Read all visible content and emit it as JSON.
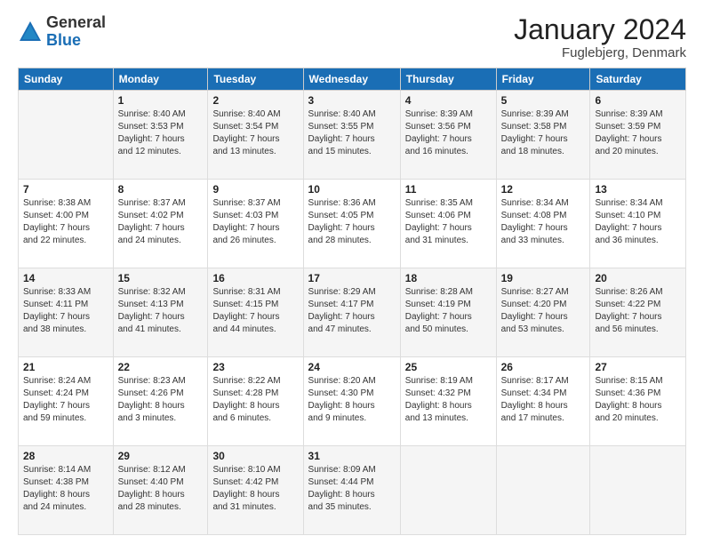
{
  "header": {
    "logo_general": "General",
    "logo_blue": "Blue",
    "month_title": "January 2024",
    "location": "Fuglebjerg, Denmark"
  },
  "days_of_week": [
    "Sunday",
    "Monday",
    "Tuesday",
    "Wednesday",
    "Thursday",
    "Friday",
    "Saturday"
  ],
  "weeks": [
    [
      {
        "day": "",
        "info": ""
      },
      {
        "day": "1",
        "info": "Sunrise: 8:40 AM\nSunset: 3:53 PM\nDaylight: 7 hours\nand 12 minutes."
      },
      {
        "day": "2",
        "info": "Sunrise: 8:40 AM\nSunset: 3:54 PM\nDaylight: 7 hours\nand 13 minutes."
      },
      {
        "day": "3",
        "info": "Sunrise: 8:40 AM\nSunset: 3:55 PM\nDaylight: 7 hours\nand 15 minutes."
      },
      {
        "day": "4",
        "info": "Sunrise: 8:39 AM\nSunset: 3:56 PM\nDaylight: 7 hours\nand 16 minutes."
      },
      {
        "day": "5",
        "info": "Sunrise: 8:39 AM\nSunset: 3:58 PM\nDaylight: 7 hours\nand 18 minutes."
      },
      {
        "day": "6",
        "info": "Sunrise: 8:39 AM\nSunset: 3:59 PM\nDaylight: 7 hours\nand 20 minutes."
      }
    ],
    [
      {
        "day": "7",
        "info": "Sunrise: 8:38 AM\nSunset: 4:00 PM\nDaylight: 7 hours\nand 22 minutes."
      },
      {
        "day": "8",
        "info": "Sunrise: 8:37 AM\nSunset: 4:02 PM\nDaylight: 7 hours\nand 24 minutes."
      },
      {
        "day": "9",
        "info": "Sunrise: 8:37 AM\nSunset: 4:03 PM\nDaylight: 7 hours\nand 26 minutes."
      },
      {
        "day": "10",
        "info": "Sunrise: 8:36 AM\nSunset: 4:05 PM\nDaylight: 7 hours\nand 28 minutes."
      },
      {
        "day": "11",
        "info": "Sunrise: 8:35 AM\nSunset: 4:06 PM\nDaylight: 7 hours\nand 31 minutes."
      },
      {
        "day": "12",
        "info": "Sunrise: 8:34 AM\nSunset: 4:08 PM\nDaylight: 7 hours\nand 33 minutes."
      },
      {
        "day": "13",
        "info": "Sunrise: 8:34 AM\nSunset: 4:10 PM\nDaylight: 7 hours\nand 36 minutes."
      }
    ],
    [
      {
        "day": "14",
        "info": "Sunrise: 8:33 AM\nSunset: 4:11 PM\nDaylight: 7 hours\nand 38 minutes."
      },
      {
        "day": "15",
        "info": "Sunrise: 8:32 AM\nSunset: 4:13 PM\nDaylight: 7 hours\nand 41 minutes."
      },
      {
        "day": "16",
        "info": "Sunrise: 8:31 AM\nSunset: 4:15 PM\nDaylight: 7 hours\nand 44 minutes."
      },
      {
        "day": "17",
        "info": "Sunrise: 8:29 AM\nSunset: 4:17 PM\nDaylight: 7 hours\nand 47 minutes."
      },
      {
        "day": "18",
        "info": "Sunrise: 8:28 AM\nSunset: 4:19 PM\nDaylight: 7 hours\nand 50 minutes."
      },
      {
        "day": "19",
        "info": "Sunrise: 8:27 AM\nSunset: 4:20 PM\nDaylight: 7 hours\nand 53 minutes."
      },
      {
        "day": "20",
        "info": "Sunrise: 8:26 AM\nSunset: 4:22 PM\nDaylight: 7 hours\nand 56 minutes."
      }
    ],
    [
      {
        "day": "21",
        "info": "Sunrise: 8:24 AM\nSunset: 4:24 PM\nDaylight: 7 hours\nand 59 minutes."
      },
      {
        "day": "22",
        "info": "Sunrise: 8:23 AM\nSunset: 4:26 PM\nDaylight: 8 hours\nand 3 minutes."
      },
      {
        "day": "23",
        "info": "Sunrise: 8:22 AM\nSunset: 4:28 PM\nDaylight: 8 hours\nand 6 minutes."
      },
      {
        "day": "24",
        "info": "Sunrise: 8:20 AM\nSunset: 4:30 PM\nDaylight: 8 hours\nand 9 minutes."
      },
      {
        "day": "25",
        "info": "Sunrise: 8:19 AM\nSunset: 4:32 PM\nDaylight: 8 hours\nand 13 minutes."
      },
      {
        "day": "26",
        "info": "Sunrise: 8:17 AM\nSunset: 4:34 PM\nDaylight: 8 hours\nand 17 minutes."
      },
      {
        "day": "27",
        "info": "Sunrise: 8:15 AM\nSunset: 4:36 PM\nDaylight: 8 hours\nand 20 minutes."
      }
    ],
    [
      {
        "day": "28",
        "info": "Sunrise: 8:14 AM\nSunset: 4:38 PM\nDaylight: 8 hours\nand 24 minutes."
      },
      {
        "day": "29",
        "info": "Sunrise: 8:12 AM\nSunset: 4:40 PM\nDaylight: 8 hours\nand 28 minutes."
      },
      {
        "day": "30",
        "info": "Sunrise: 8:10 AM\nSunset: 4:42 PM\nDaylight: 8 hours\nand 31 minutes."
      },
      {
        "day": "31",
        "info": "Sunrise: 8:09 AM\nSunset: 4:44 PM\nDaylight: 8 hours\nand 35 minutes."
      },
      {
        "day": "",
        "info": ""
      },
      {
        "day": "",
        "info": ""
      },
      {
        "day": "",
        "info": ""
      }
    ]
  ]
}
